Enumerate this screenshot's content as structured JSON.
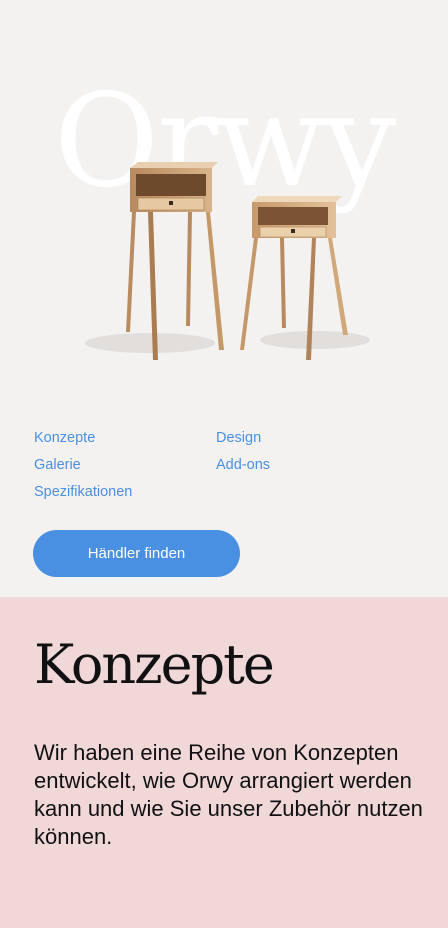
{
  "hero": {
    "brand_title": "Orwy",
    "image_alt": "Orwy bedside tables",
    "accent_color": "#4a90e2",
    "background_color": "#f4f2f0"
  },
  "nav": {
    "links": [
      "Konzepte",
      "Design",
      "Galerie",
      "Add-ons",
      "Spezifikationen"
    ]
  },
  "cta": {
    "label": "Händler finden"
  },
  "section": {
    "heading": "Konzepte",
    "body": "Wir haben eine Reihe von Konzepten entwickelt, wie Orwy arrangiert werden kann und wie Sie unser Zubehör nutzen können.",
    "background_color": "#f1d8d8"
  }
}
